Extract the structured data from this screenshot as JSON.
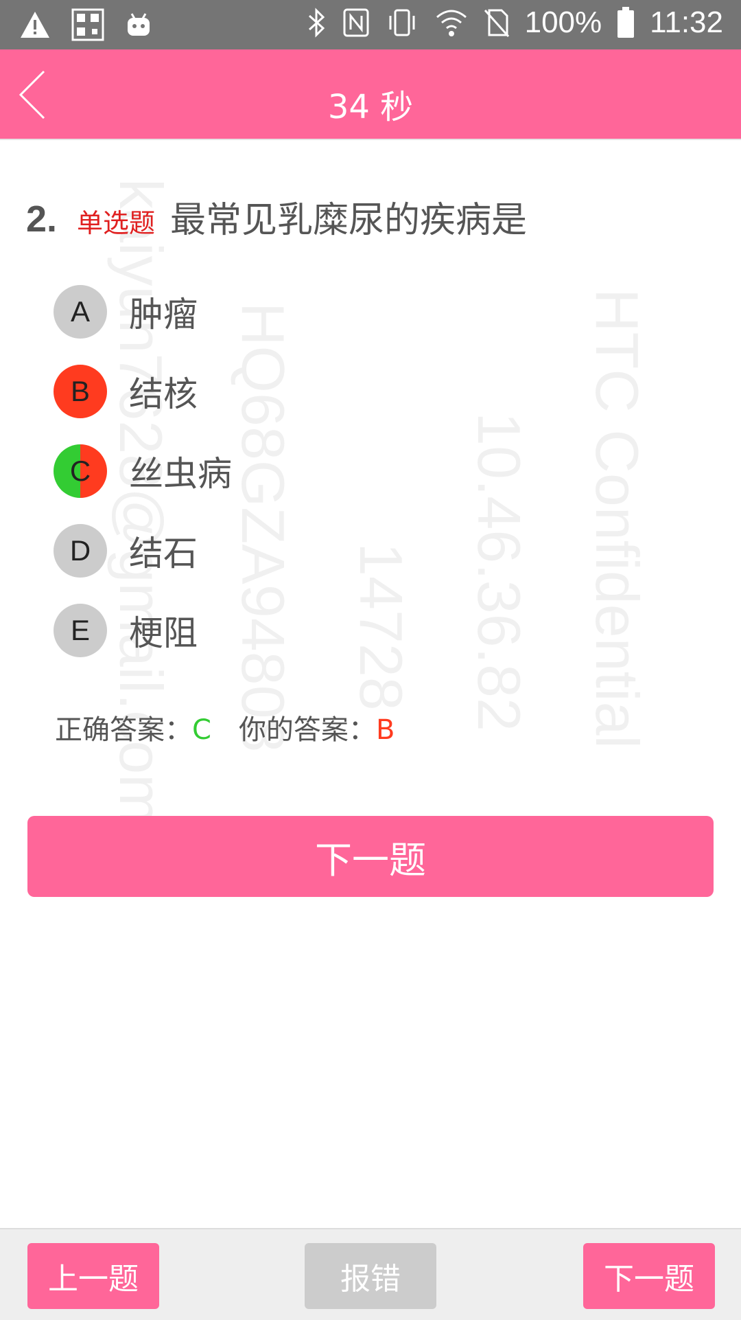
{
  "status_bar": {
    "battery": "100%",
    "time": "11:32"
  },
  "header": {
    "timer": "34 秒"
  },
  "question": {
    "number": "2.",
    "type_label": "单选题",
    "text": "最常见乳糜尿的疾病是"
  },
  "options": [
    {
      "letter": "A",
      "text": "肿瘤",
      "state": "neutral"
    },
    {
      "letter": "B",
      "text": "结核",
      "state": "selected-wrong"
    },
    {
      "letter": "C",
      "text": "丝虫病",
      "state": "correct-and-selected"
    },
    {
      "letter": "D",
      "text": "结石",
      "state": "neutral"
    },
    {
      "letter": "E",
      "text": "梗阻",
      "state": "neutral"
    }
  ],
  "result": {
    "correct_label": "正确答案：",
    "correct_value": "C",
    "your_label": "你的答案：",
    "your_value": "B"
  },
  "next_button": "下一题",
  "bottom": {
    "prev": "上一题",
    "report": "报错",
    "next": "下一题"
  },
  "watermarks": [
    "kaiyun7628@gmail.com",
    "HQ68GZA94808",
    "14728",
    "10.46.36.82",
    "HTC Confidential"
  ],
  "colors": {
    "accent": "#ff6699",
    "wrong": "#ff3b1f",
    "correct": "#33cc33",
    "neutral": "#cccccc"
  }
}
